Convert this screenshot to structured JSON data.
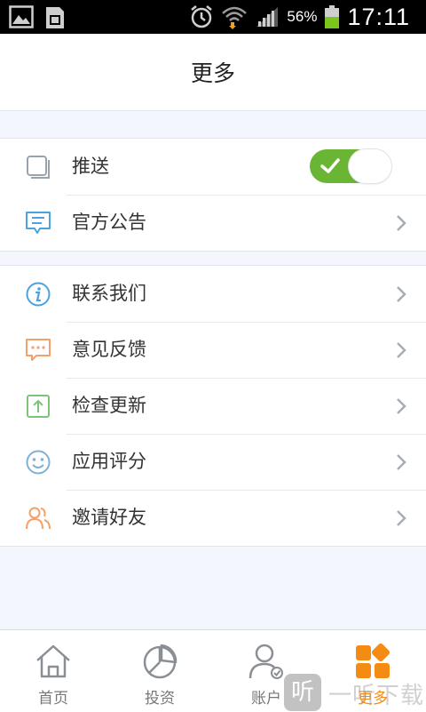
{
  "status_bar": {
    "battery_percent": "56%",
    "time": "17:11",
    "icons": [
      "gallery-icon",
      "sim-card-icon",
      "alarm-icon",
      "wifi-icon",
      "signal-icon",
      "battery-icon"
    ]
  },
  "header": {
    "title": "更多"
  },
  "group1": {
    "items": [
      {
        "label": "推送",
        "icon": "push-icon",
        "control": "toggle",
        "toggle_on": true
      },
      {
        "label": "官方公告",
        "icon": "announcement-icon",
        "control": "chevron"
      }
    ]
  },
  "group2": {
    "items": [
      {
        "label": "联系我们",
        "icon": "info-icon"
      },
      {
        "label": "意见反馈",
        "icon": "feedback-icon"
      },
      {
        "label": "检查更新",
        "icon": "update-icon"
      },
      {
        "label": "应用评分",
        "icon": "smiley-icon"
      },
      {
        "label": "邀请好友",
        "icon": "invite-friends-icon"
      }
    ]
  },
  "tabbar": {
    "tabs": [
      {
        "label": "首页",
        "icon": "home-icon",
        "active": false
      },
      {
        "label": "投资",
        "icon": "pie-chart-icon",
        "active": false
      },
      {
        "label": "账户",
        "icon": "account-icon",
        "active": false
      },
      {
        "label": "更多",
        "icon": "more-grid-icon",
        "active": true
      }
    ]
  },
  "watermark": {
    "badge": "听",
    "text": "一听下载"
  },
  "colors": {
    "accent_green": "#6ab534",
    "accent_orange": "#f48c14",
    "background": "#f3f7fd",
    "icon_blue": "#4aa3df",
    "icon_orange": "#f5a06a",
    "icon_green": "#7cc47a",
    "icon_teal": "#7fb1d6"
  }
}
